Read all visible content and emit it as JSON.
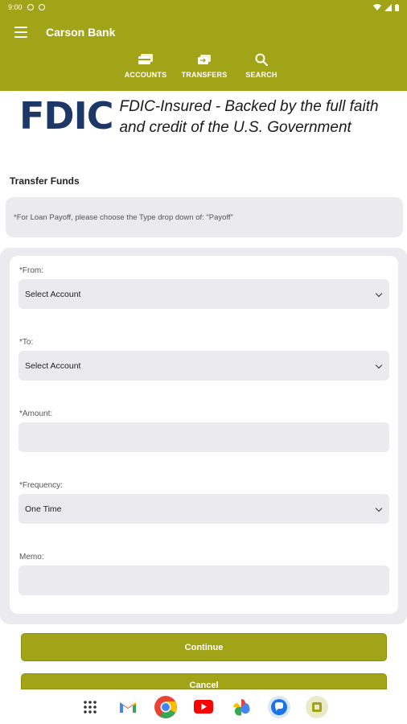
{
  "status_bar": {
    "time": "9:00"
  },
  "app": {
    "title": "Carson Bank",
    "brand_color": "#a2a417"
  },
  "nav": {
    "items": [
      {
        "label": "ACCOUNTS",
        "icon": "credit-card-icon"
      },
      {
        "label": "TRANSFERS",
        "icon": "transfer-icon"
      },
      {
        "label": "SEARCH",
        "icon": "search-icon"
      }
    ]
  },
  "fdic": {
    "logo": "FDIC",
    "line1": "FDIC-Insured - Backed by the full faith",
    "line2": "and credit of the U.S. Government"
  },
  "page": {
    "title": "Transfer Funds",
    "note": "*For Loan Payoff, please choose the Type drop down of: \"Payoff\""
  },
  "form": {
    "from_label": "*From:",
    "from_value": "Select Account",
    "to_label": "*To:",
    "to_value": "Select Account",
    "amount_label": "*Amount:",
    "amount_value": "",
    "frequency_label": "*Frequency:",
    "frequency_value": "One Time",
    "memo_label": "Memo:",
    "memo_value": ""
  },
  "actions": {
    "continue_label": "Continue",
    "cancel_label": "Cancel"
  },
  "dock": {
    "apps": [
      "app-drawer-icon",
      "gmail-icon",
      "chrome-icon",
      "youtube-icon",
      "photos-icon",
      "messages-icon",
      "notes-app-icon"
    ]
  }
}
